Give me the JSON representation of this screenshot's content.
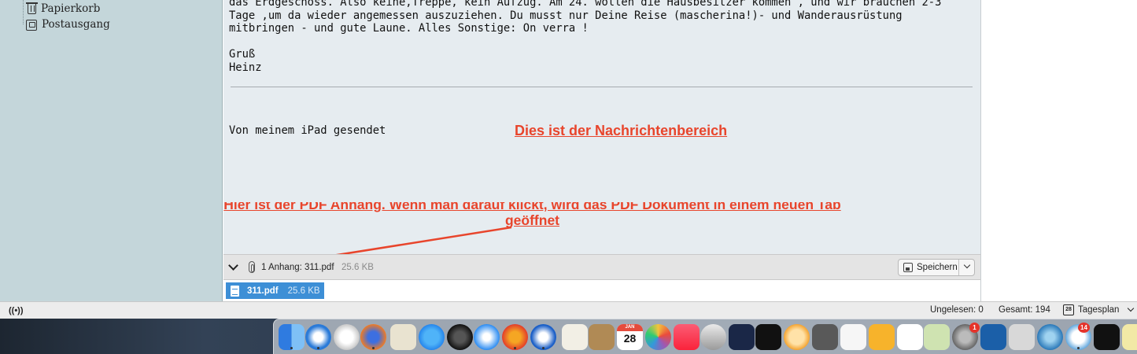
{
  "sidebar": {
    "folders": [
      {
        "label": "Papierkorb",
        "icon": "trash-icon"
      },
      {
        "label": "Postausgang",
        "icon": "outbox-icon"
      }
    ]
  },
  "message": {
    "body_lines": [
      "das Erdgeschoss. Also keine,Treppe, kein Aufzug. Am 24. wollen die Hausbesitzer kommen , und wir brauchen 2-3",
      "Tage ,um da wieder angemessen auszuziehen. Du musst nur Deine Reise (mascherina!)- und Wanderausrüstung",
      "mitbringen - und gute Laune. Alles Sonstige: On verra !",
      "",
      "Gruß",
      "Heinz"
    ],
    "signature": "Von meinem iPad gesendet",
    "annotation_message_area": "Dies ist der Nachrichtenbereich",
    "annotation_attachment_line1": "Hier ist der PDF Anhang. Wenn man darauf klickt, wird das PDF Dokument in einem neuen Tab",
    "annotation_attachment_line2": "geöffnet"
  },
  "attachment_bar": {
    "label": "1 Anhang: 311.pdf",
    "size": "25.6 KB",
    "save_label": "Speichern"
  },
  "attachments": [
    {
      "name": "311.pdf",
      "size": "25.6 KB"
    }
  ],
  "statusbar": {
    "unread": "Ungelesen: 0",
    "total": "Gesamt: 194",
    "calendar_day": "28",
    "today_pane": "Tagesplan"
  },
  "dock": {
    "calendar_month": "JAN",
    "calendar_day": "28",
    "badges": [
      "1",
      "14"
    ]
  },
  "colors": {
    "annotation": "#e8452c",
    "sidebar_bg": "#c4d6da",
    "message_bg": "#e6ecf0",
    "attachment_selected": "#3d8fd6"
  }
}
